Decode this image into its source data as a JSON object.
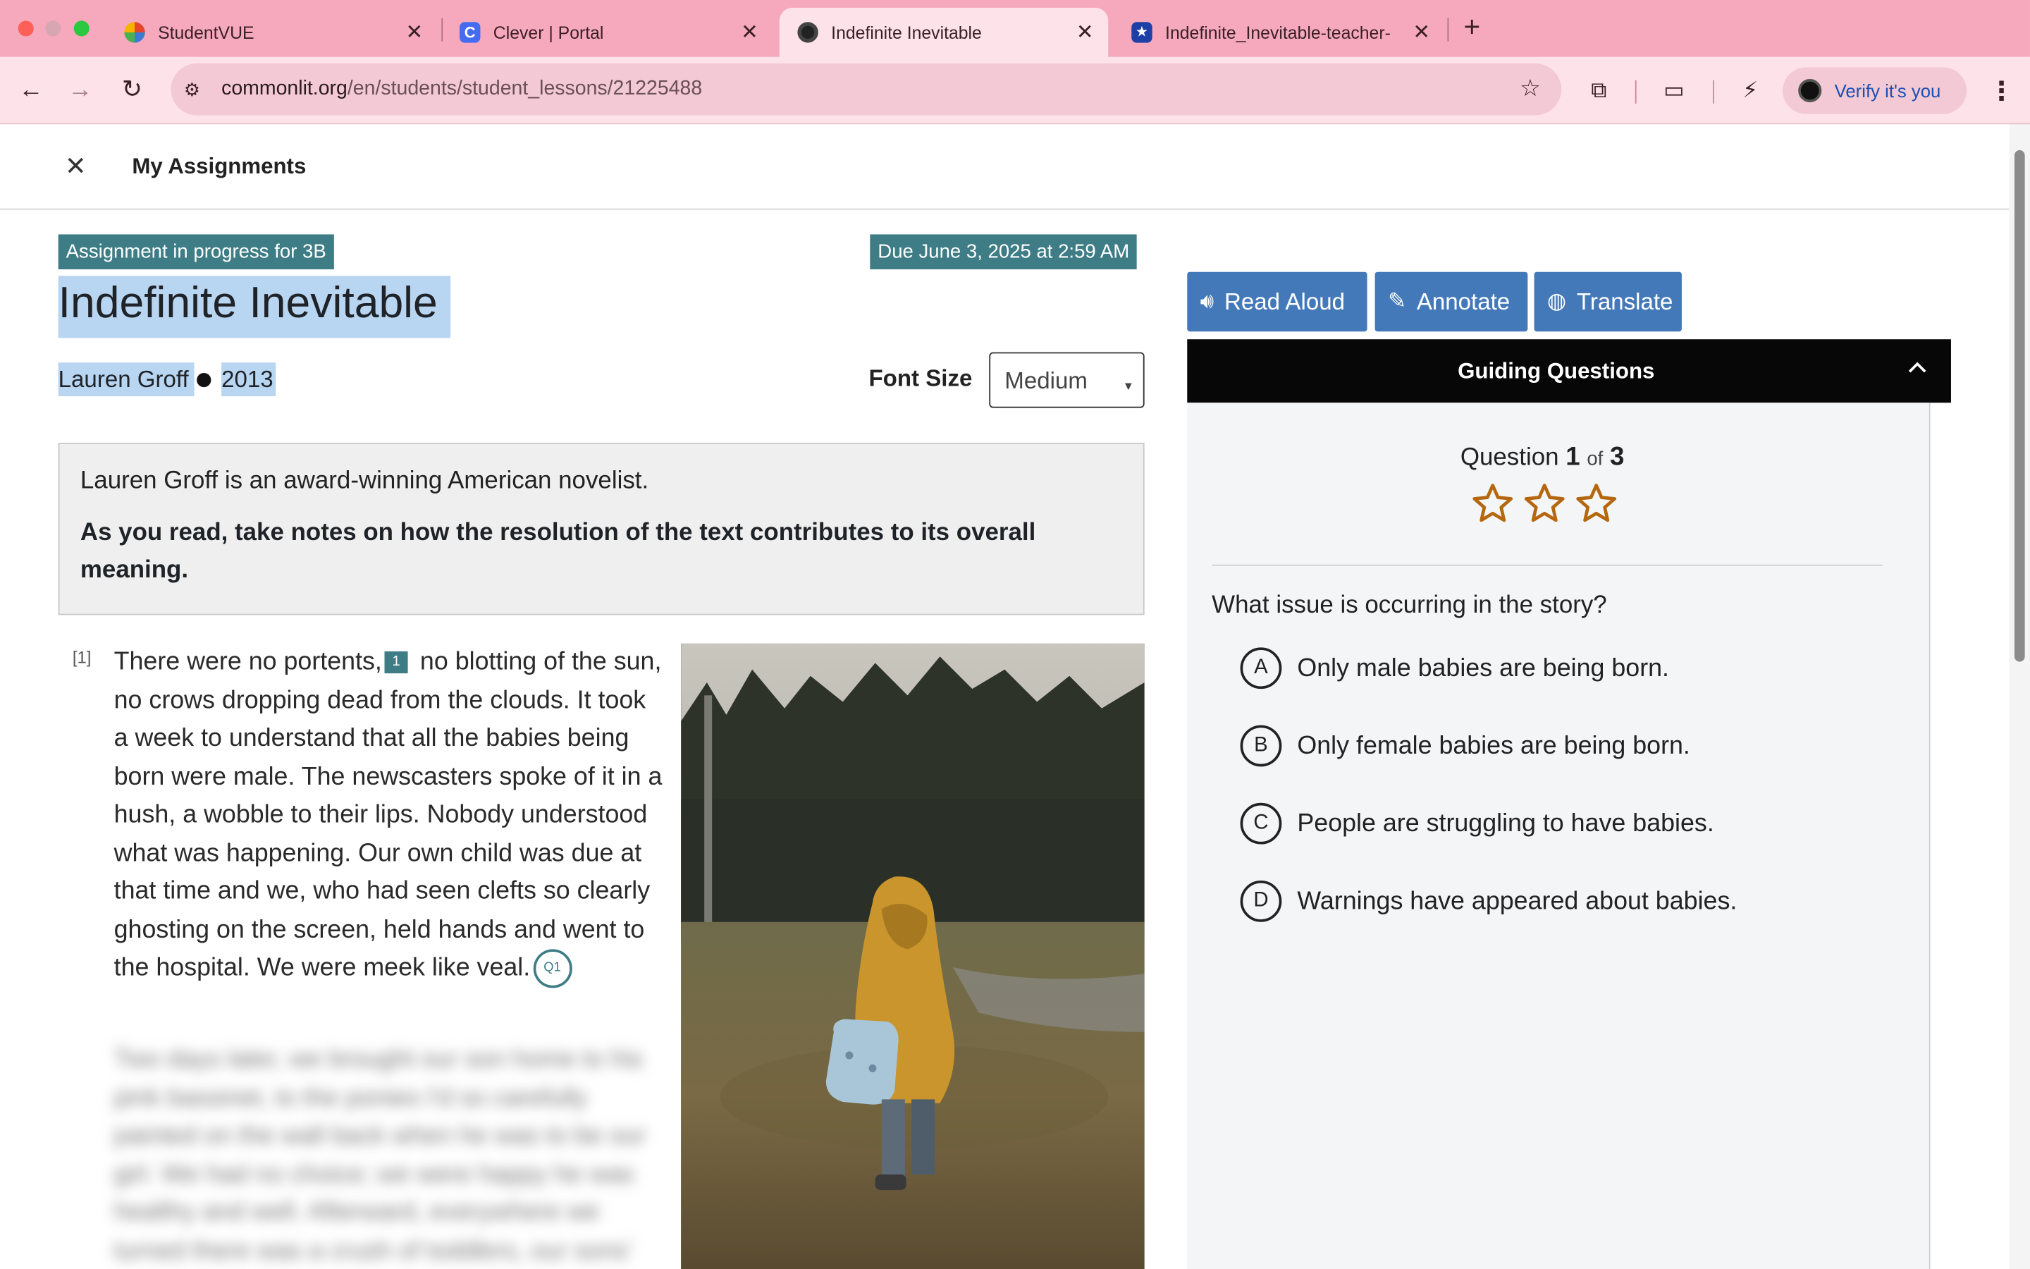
{
  "browser": {
    "tabs": [
      {
        "title": "StudentVUE",
        "active": false
      },
      {
        "title": "Clever | Portal",
        "active": false
      },
      {
        "title": "Indefinite Inevitable",
        "active": true
      },
      {
        "title": "Indefinite_Inevitable-teacher-",
        "active": false
      }
    ],
    "url_domain": "commonlit.org",
    "url_path": "/en/students/student_lessons/21225488",
    "profile_label": "Verify it's you",
    "icons": [
      "back-icon",
      "forward-icon",
      "reload-icon",
      "site-settings-icon",
      "bookmark-star-icon",
      "extensions-icon",
      "tab-search-icon",
      "performance-icon",
      "kebab-menu-icon"
    ]
  },
  "app_header": {
    "close_icon": "close-icon",
    "title": "My Assignments"
  },
  "assignment": {
    "status_badge": "Assignment in progress for 3B",
    "due_badge": "Due June 3, 2025 at 2:59 AM",
    "title": "Indefinite Inevitable",
    "author": "Lauren Groff",
    "year": "2013",
    "font_size_label": "Font Size",
    "font_size_value": "Medium",
    "intro_text": "Lauren Groff is an award-winning American novelist.",
    "intro_prompt": "As you read, take notes on how the resolution of the text contributes to its overall meaning."
  },
  "passage": {
    "paragraph_number": "[1]",
    "text_before_footnote": "There were no portents,",
    "footnote_number": "1",
    "text_after_footnote": " no blotting of the sun, no crows dropping dead from the clouds. It took a week to understand that all the babies being born were male. The newscasters spoke of it in a hush, a wobble to their lips. Nobody understood what was happening. Our own child was due at that time and we, who had seen clefts so clearly ghosting on the screen, held hands and went to the hospital. We were meek like veal.",
    "question_marker": "Q1",
    "blurred_text": "Two days later, we brought our son home to his pink bassinet, to the ponies I'd so carefully painted on the wall back when he was to be our girl. We had no choice; we were happy he was healthy and well. Afterward, everywhere we turned there was a crush of toddlers, our sons'"
  },
  "tools": [
    {
      "label": "Read Aloud",
      "icon": "speaker-icon"
    },
    {
      "label": "Annotate",
      "icon": "pen-icon"
    },
    {
      "label": "Translate",
      "icon": "globe-icon"
    }
  ],
  "guiding_questions": {
    "header": "Guiding Questions",
    "question_word": "Question",
    "current": "1",
    "of_word": "of",
    "total": "3",
    "stars": 3,
    "question_text": "What issue is occurring in the story?",
    "options": [
      {
        "letter": "A",
        "text": "Only male babies are being born."
      },
      {
        "letter": "B",
        "text": "Only female babies are being born."
      },
      {
        "letter": "C",
        "text": "People are struggling to have babies."
      },
      {
        "letter": "D",
        "text": "Warnings have appeared about babies."
      }
    ]
  },
  "colors": {
    "tab_bar": "#f6a9bd",
    "toolbar": "#fde2e9",
    "teal_badge": "#3e7d86",
    "tool_button": "#4479b9",
    "selection_highlight": "#b8d5f2",
    "star_outline": "#b5670f"
  }
}
